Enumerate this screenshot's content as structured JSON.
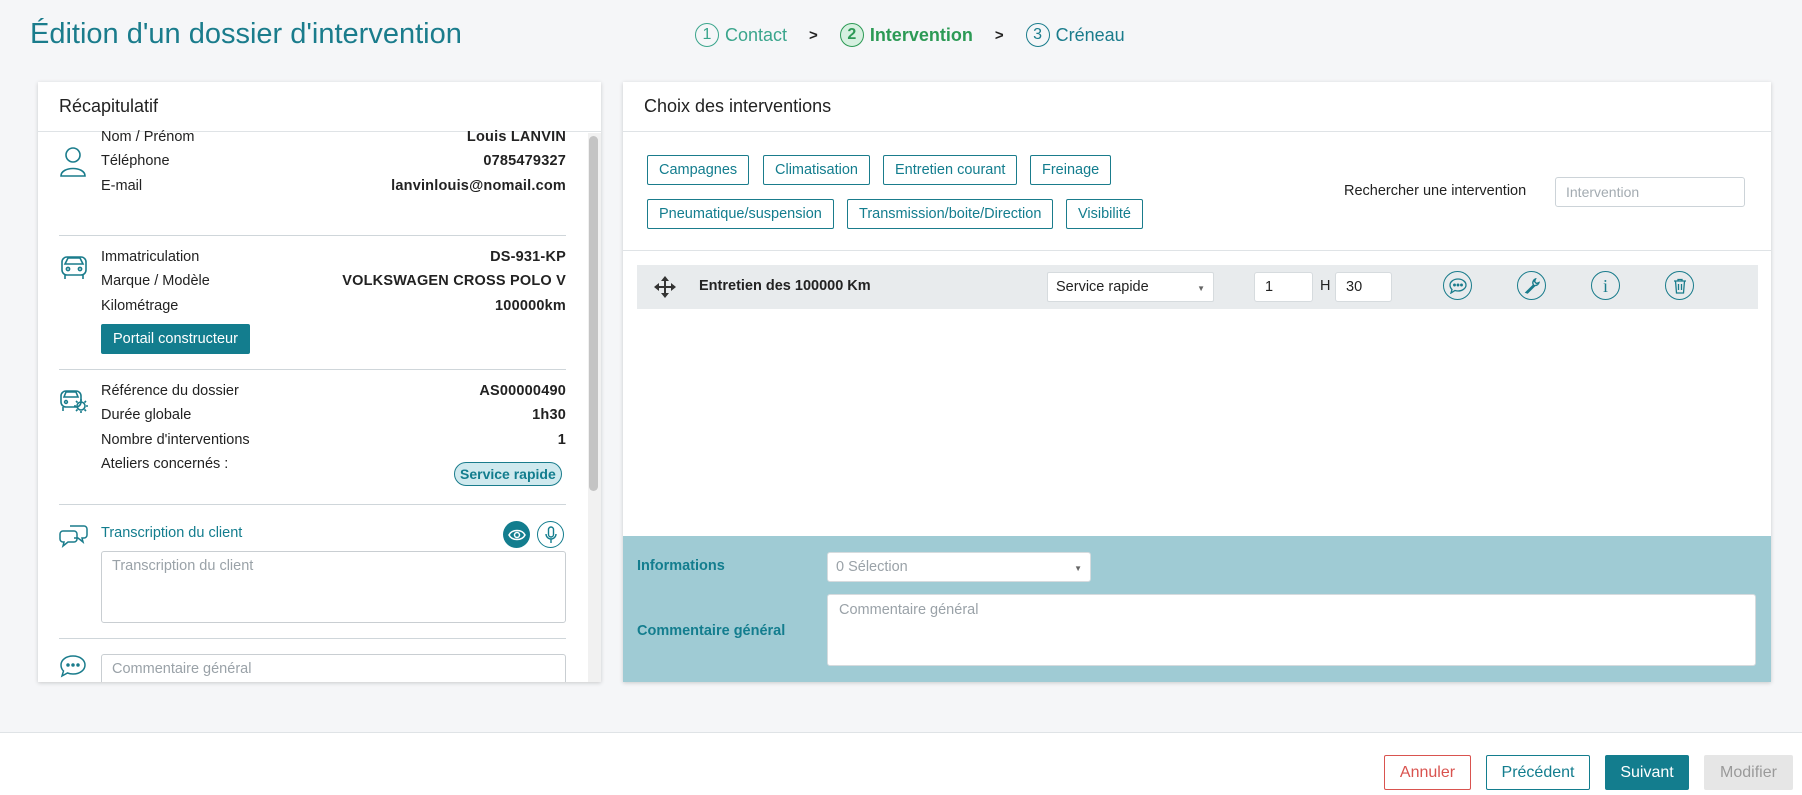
{
  "page": {
    "title": "Édition d'un dossier d'intervention"
  },
  "stepper": {
    "steps": [
      {
        "num": "1",
        "label": "Contact"
      },
      {
        "num": "2",
        "label": "Intervention"
      },
      {
        "num": "3",
        "label": "Créneau"
      }
    ],
    "separator": ">"
  },
  "recap": {
    "title": "Récapitulatif",
    "client": {
      "name_label": "Nom / Prénom",
      "name_value": "Louis LANVIN",
      "phone_label": "Téléphone",
      "phone_value": "0785479327",
      "email_label": "E-mail",
      "email_value": "lanvinlouis@nomail.com"
    },
    "vehicle": {
      "plate_label": "Immatriculation",
      "plate_value": "DS-931-KP",
      "model_label": "Marque / Modèle",
      "model_value": "VOLKSWAGEN CROSS POLO V",
      "km_label": "Kilométrage",
      "km_value": "100000km",
      "portal_button": "Portail constructeur"
    },
    "dossier": {
      "ref_label": "Référence du dossier",
      "ref_value": "AS00000490",
      "duration_label": "Durée globale",
      "duration_value": "1h30",
      "count_label": "Nombre d'interventions",
      "count_value": "1",
      "workshops_label": "Ateliers concernés :",
      "workshop_badge": "Service rapide"
    },
    "transcription": {
      "label": "Transcription du client",
      "placeholder": "Transcription du client"
    },
    "comment": {
      "placeholder": "Commentaire général"
    }
  },
  "choices": {
    "title": "Choix des interventions",
    "chips": [
      "Campagnes",
      "Climatisation",
      "Entretien courant",
      "Freinage",
      "Pneumatique/suspension",
      "Transmission/boite/Direction",
      "Visibilité"
    ],
    "search_label": "Rechercher une intervention",
    "search_placeholder": "Intervention",
    "row": {
      "title": "Entretien des 100000 Km",
      "workshop": "Service rapide",
      "hours": "1",
      "hours_unit": "H",
      "minutes": "30"
    },
    "info_label": "Informations",
    "info_select": "0 Sélection",
    "comment_label": "Commentaire général",
    "comment_placeholder": "Commentaire général"
  },
  "footer": {
    "cancel": "Annuler",
    "previous": "Précédent",
    "next": "Suivant",
    "modify": "Modifier"
  },
  "colors": {
    "accent": "#137d8e",
    "success": "#2c9a55",
    "danger": "#d9534f",
    "info_panel": "#9fcbd4"
  }
}
